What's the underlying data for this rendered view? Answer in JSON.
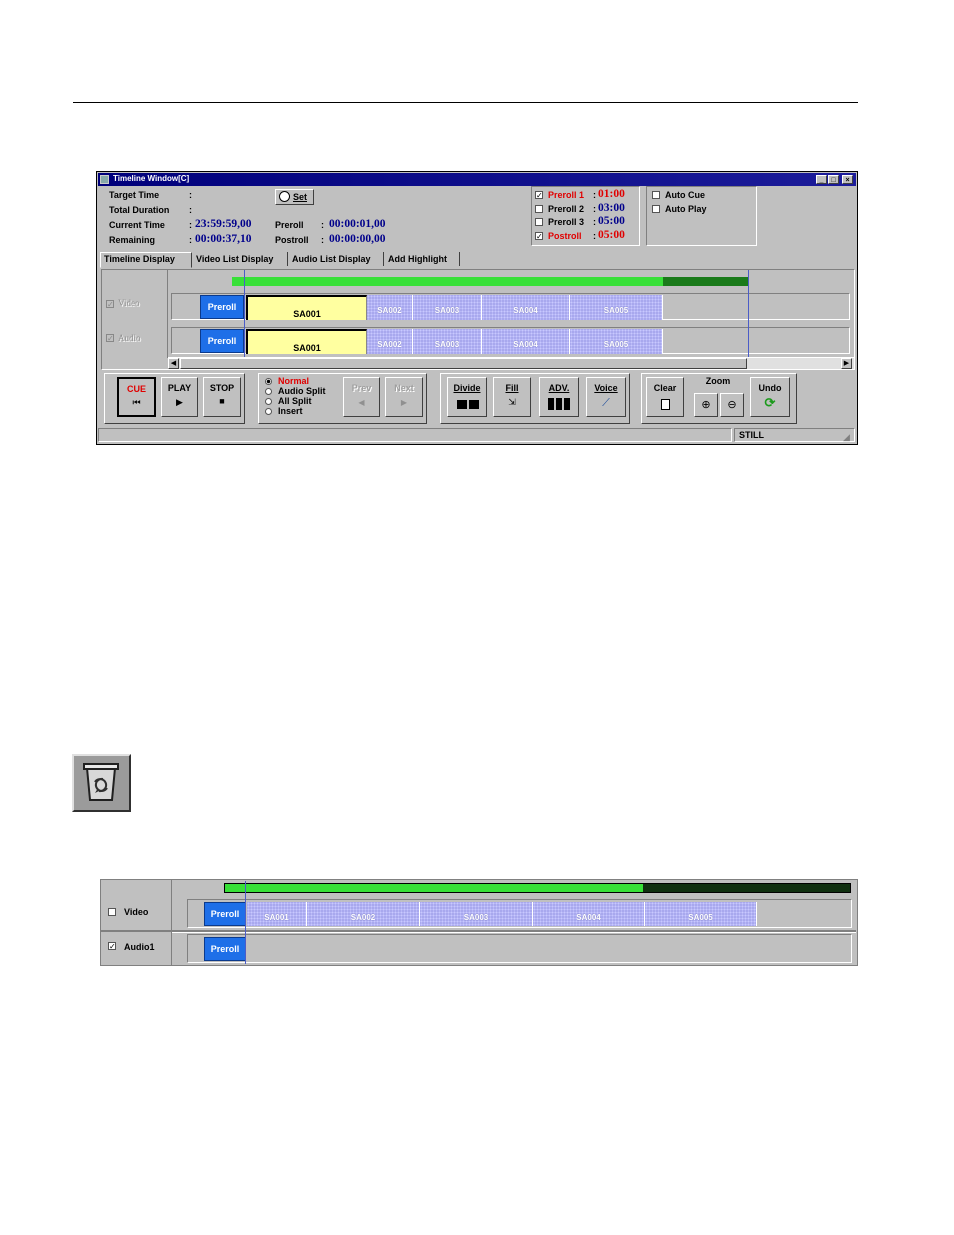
{
  "window": {
    "title": "Timeline Window[C]",
    "controls": {
      "minimize": "_",
      "maximize": "□",
      "close": "×"
    }
  },
  "info": {
    "target_time_label": "Target Time",
    "total_duration_label": "Total Duration",
    "current_time_label": "Current Time",
    "remaining_label": "Remaining",
    "colon": ":",
    "current_time_value": "23:59:59,00",
    "remaining_value": "00:00:37,10",
    "preroll_label": "Preroll",
    "preroll_value": "00:00:01,00",
    "postroll_label": "Postroll",
    "postroll_value": "00:00:00,00",
    "set_button": "Set"
  },
  "prerolls": [
    {
      "label": "Preroll 1",
      "value": "01:00",
      "checked": true,
      "active": true
    },
    {
      "label": "Preroll 2",
      "value": "03:00",
      "checked": false,
      "active": false
    },
    {
      "label": "Preroll 3",
      "value": "05:00",
      "checked": false,
      "active": false
    },
    {
      "label": "Postroll",
      "value": "05:00",
      "checked": true,
      "active": true
    }
  ],
  "auto": {
    "cue_label": "Auto Cue",
    "play_label": "Auto Play"
  },
  "tabs": [
    "Timeline Display",
    "Video List Display",
    "Audio List Display",
    "Add Highlight"
  ],
  "tracks": {
    "video_label": "Video",
    "audio_label": "Audio",
    "preroll_clip": "Preroll",
    "clips": [
      "SA001",
      "SA002",
      "SA003",
      "SA004",
      "SA005"
    ]
  },
  "toolbar": {
    "cue": "CUE",
    "play": "PLAY",
    "stop": "STOP",
    "modes": [
      "Normal",
      "Audio Split",
      "All Split",
      "Insert"
    ],
    "prev": "Prev",
    "next": "Next",
    "divide": "Divide",
    "fill": "Fill",
    "adv": "ADV.",
    "voice": "Voice",
    "clear": "Clear",
    "zoom": "Zoom",
    "undo": "Undo"
  },
  "status": {
    "text": "STILL"
  },
  "lower_timeline": {
    "video_label": "Video",
    "audio_label": "Audio1",
    "preroll_clip": "Preroll",
    "clips": [
      "SA001",
      "SA002",
      "SA003",
      "SA004",
      "SA005"
    ]
  },
  "colors": {
    "progress_green": "#38e038",
    "progress_dark": "#1a7a1a",
    "preroll_blue": "#1e6fe8",
    "clip_purple": "#a8a8ee",
    "clip_yellow": "#ffffa0",
    "time_blue": "#00008b",
    "alert_red": "#e00000"
  }
}
